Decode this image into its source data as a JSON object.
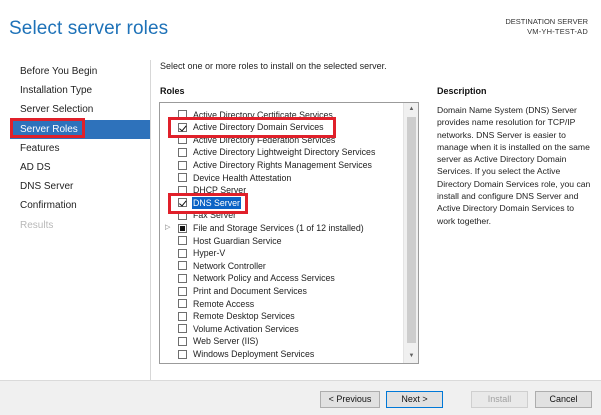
{
  "header": {
    "title": "Select server roles",
    "destination_label": "DESTINATION SERVER",
    "destination_value": "VM-YH-TEST-AD"
  },
  "nav": [
    {
      "label": "Before You Begin",
      "state": "normal"
    },
    {
      "label": "Installation Type",
      "state": "normal"
    },
    {
      "label": "Server Selection",
      "state": "normal"
    },
    {
      "label": "Server Roles",
      "state": "selected"
    },
    {
      "label": "Features",
      "state": "normal"
    },
    {
      "label": "AD DS",
      "state": "normal"
    },
    {
      "label": "DNS Server",
      "state": "normal"
    },
    {
      "label": "Confirmation",
      "state": "normal"
    },
    {
      "label": "Results",
      "state": "disabled"
    }
  ],
  "main": {
    "instruction": "Select one or more roles to install on the selected server.",
    "roles_heading": "Roles",
    "roles": [
      {
        "label": "Active Directory Certificate Services",
        "state": "unchecked"
      },
      {
        "label": "Active Directory Domain Services",
        "state": "checked"
      },
      {
        "label": "Active Directory Federation Services",
        "state": "unchecked"
      },
      {
        "label": "Active Directory Lightweight Directory Services",
        "state": "unchecked"
      },
      {
        "label": "Active Directory Rights Management Services",
        "state": "unchecked"
      },
      {
        "label": "Device Health Attestation",
        "state": "unchecked"
      },
      {
        "label": "DHCP Server",
        "state": "unchecked"
      },
      {
        "label": "DNS Server",
        "state": "checked",
        "selected": true
      },
      {
        "label": "Fax Server",
        "state": "unchecked"
      },
      {
        "label": "File and Storage Services (1 of 12 installed)",
        "state": "partial",
        "expandable": true
      },
      {
        "label": "Host Guardian Service",
        "state": "unchecked"
      },
      {
        "label": "Hyper-V",
        "state": "unchecked"
      },
      {
        "label": "Network Controller",
        "state": "unchecked"
      },
      {
        "label": "Network Policy and Access Services",
        "state": "unchecked"
      },
      {
        "label": "Print and Document Services",
        "state": "unchecked"
      },
      {
        "label": "Remote Access",
        "state": "unchecked"
      },
      {
        "label": "Remote Desktop Services",
        "state": "unchecked"
      },
      {
        "label": "Volume Activation Services",
        "state": "unchecked"
      },
      {
        "label": "Web Server (IIS)",
        "state": "unchecked"
      },
      {
        "label": "Windows Deployment Services",
        "state": "unchecked"
      }
    ]
  },
  "description": {
    "heading": "Description",
    "text": "Domain Name System (DNS) Server provides name resolution for TCP/IP networks. DNS Server is easier to manage when it is installed on the same server as Active Directory Domain Services. If you select the Active Directory Domain Services role, you can install and configure DNS Server and Active Directory Domain Services to work together."
  },
  "footer": {
    "previous": "< Previous",
    "next": "Next >",
    "install": "Install",
    "cancel": "Cancel"
  },
  "colors": {
    "title": "#1e72b8",
    "nav_selected_bg": "#2e72bb",
    "annotation": "#e0202a",
    "selection_bg": "#0b63c5"
  },
  "icons": {
    "expander": "triangle-right-icon",
    "scroll_up": "chevron-up-icon",
    "scroll_down": "chevron-down-icon"
  }
}
